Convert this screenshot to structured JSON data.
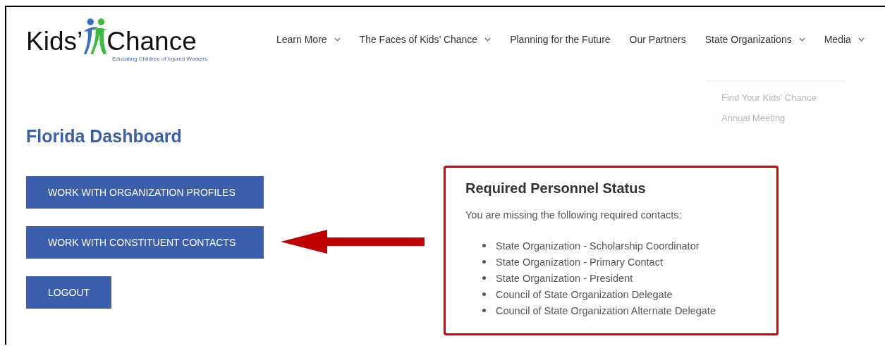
{
  "logo": {
    "word_left": "Kids’",
    "word_right": "Chance",
    "tagline": "Educating Children of Injured Workers"
  },
  "nav": [
    {
      "label": "Learn More",
      "has_dropdown": true
    },
    {
      "label": "The Faces of Kids’ Chance",
      "has_dropdown": true
    },
    {
      "label": "Planning for the Future",
      "has_dropdown": false
    },
    {
      "label": "Our Partners",
      "has_dropdown": false
    },
    {
      "label": "State Organizations",
      "has_dropdown": true
    },
    {
      "label": "Media",
      "has_dropdown": true
    }
  ],
  "faded_menu": [
    "Find Your Kids’ Chance",
    "Annual Meeting"
  ],
  "heading": "Florida Dashboard",
  "buttons": [
    "WORK WITH ORGANIZATION PROFILES",
    "WORK WITH CONSTITUENT CONTACTS",
    "LOGOUT"
  ],
  "status_panel": {
    "title": "Required Personnel Status",
    "message": "You are missing the following required contacts:",
    "items": [
      "State Organization - Scholarship Coordinator",
      "State Organization - Primary Contact",
      "State Organization - President",
      "Council of State Organization Delegate",
      "Council of State Organization Alternate Delegate"
    ]
  }
}
